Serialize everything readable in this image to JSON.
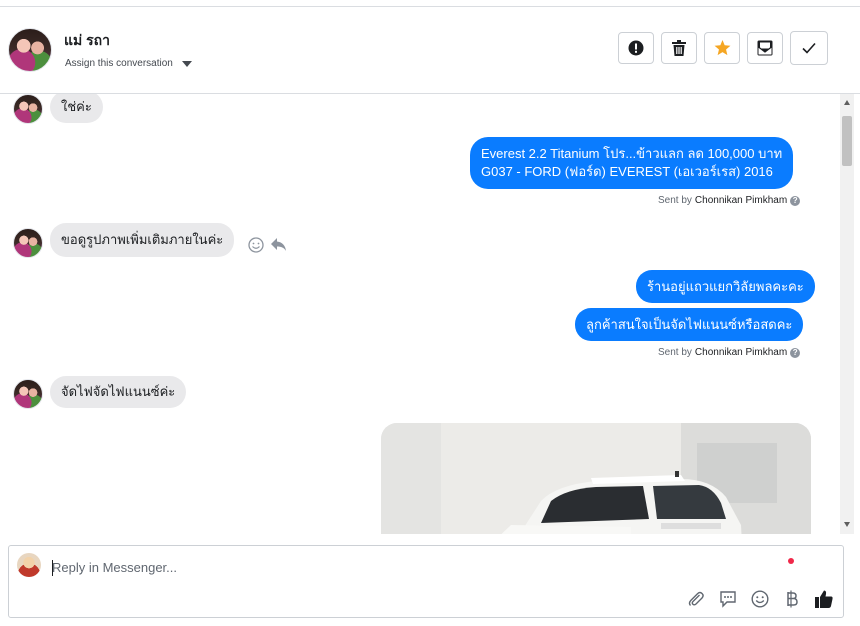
{
  "header": {
    "contact_name": "แม่ รถา",
    "assign_label": "Assign this conversation"
  },
  "toolbar": {
    "buttons": [
      {
        "name": "mark-spam",
        "icon": "exclamation-circle-icon"
      },
      {
        "name": "delete",
        "icon": "trash-icon"
      },
      {
        "name": "star",
        "icon": "star-icon",
        "color": "#f5a623"
      },
      {
        "name": "mark-unread",
        "icon": "envelope-icon"
      },
      {
        "name": "mark-done",
        "icon": "check-icon"
      }
    ]
  },
  "messages": [
    {
      "direction": "in",
      "text": "ใช่ค่ะ"
    },
    {
      "direction": "out",
      "lines": [
        "Everest 2.2 Titanium โปร...ข้าวแลก ลด 100,000 บาท",
        "G037 - FORD (ฟอร์ด) EVEREST (เอเวอร์เรส) 2016"
      ]
    },
    {
      "direction": "sentby",
      "prefix": "Sent by",
      "agent": "Chonnikan Pimkham"
    },
    {
      "direction": "in",
      "text": "ขอดูรูปภาพเพิ่มเติมภายในค่ะ"
    },
    {
      "direction": "out",
      "text": "ร้านอยู่แถวแยกวิลัยพลคะคะ"
    },
    {
      "direction": "out",
      "text": "ลูกค้าสนใจเป็นจัดไฟแนนซ์หรือสดคะ"
    },
    {
      "direction": "sentby",
      "prefix": "Sent by",
      "agent": "Chonnikan Pimkham"
    },
    {
      "direction": "in",
      "text": "จัดไฟจัดไฟแนนซ์ค่ะ"
    },
    {
      "direction": "out",
      "type": "image",
      "subject": "white SUV photo"
    }
  ],
  "composer": {
    "placeholder": "Reply in Messenger...",
    "icons": [
      "attachment-icon",
      "saved-reply-icon",
      "emoji-icon",
      "baht-payment-icon",
      "thumbs-up-icon"
    ]
  },
  "colors": {
    "outgoing": "#0a7cff",
    "incoming": "#e9e9eb",
    "star": "#f5a623",
    "badge": "#f02849"
  }
}
